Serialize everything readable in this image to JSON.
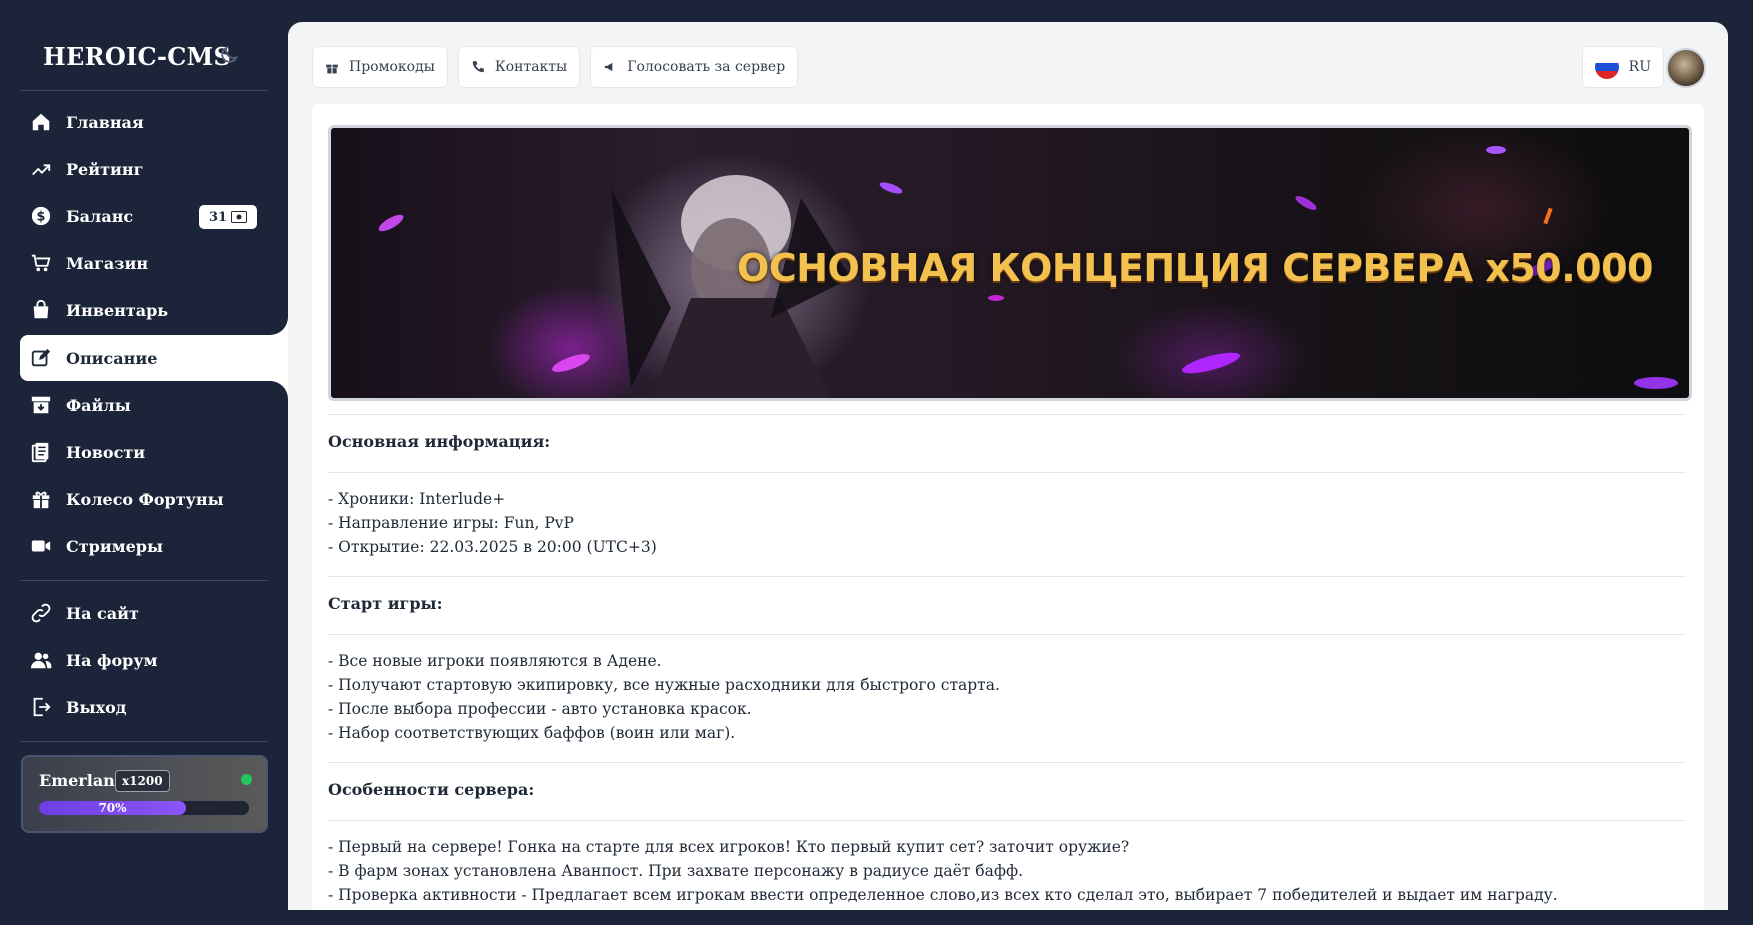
{
  "brand": {
    "title": "HEROIC-CMS"
  },
  "nav": {
    "home": "Главная",
    "rating": "Рейтинг",
    "balance": "Баланс",
    "balance_value": "31",
    "shop": "Магазин",
    "inventory": "Инвентарь",
    "description": "Описание",
    "files": "Файлы",
    "news": "Новости",
    "wheel": "Колесо Фортуны",
    "streamers": "Стримеры",
    "site": "На сайт",
    "forum": "На форум",
    "logout": "Выход"
  },
  "server": {
    "name": "Emerland",
    "rate": "x1200",
    "progress_label": "70%",
    "progress": 0.7,
    "status_color": "#22c55e"
  },
  "topbar": {
    "promo": "Промокоды",
    "contacts": "Контакты",
    "vote": "Голосовать за сервер",
    "lang": "RU"
  },
  "banner": {
    "text": "ОСНОВНАЯ КОНЦЕПЦИЯ СЕРВЕРА x50.000"
  },
  "sections": {
    "main_info": {
      "title": "Основная информация:",
      "lines": [
        "- Хроники: Interlude+",
        "- Направление игры: Fun, PvP",
        "- Открытие: 22.03.2025 в 20:00 (UTC+3)"
      ]
    },
    "start": {
      "title": "Старт игры:",
      "lines": [
        "- Все новые игроки появляются в Адене.",
        "- Получают стартовую экипировку, все нужные расходники для быстрого старта.",
        "- После выбора профессии - авто установка красок.",
        "- Набор соответствующих баффов (воин или маг)."
      ]
    },
    "features": {
      "title": "Особенности сервера:",
      "lines": [
        "- Первый на сервере! Гонка на старте для всех игроков! Кто первый купит сет? заточит оружие?",
        "- В фарм зонах установлена Аванпост. При захвате персонажу в радиусе даёт бафф.",
        "- Проверка активности - Предлагает всем игрокам ввести определенное слово,из всех кто сделал это, выбирает 7 победителей и выдает им награду."
      ]
    }
  },
  "colors": {
    "sidebar_bg": "#1b2438",
    "accent": "#7c4dff",
    "banner_text": "#f2c14e"
  }
}
